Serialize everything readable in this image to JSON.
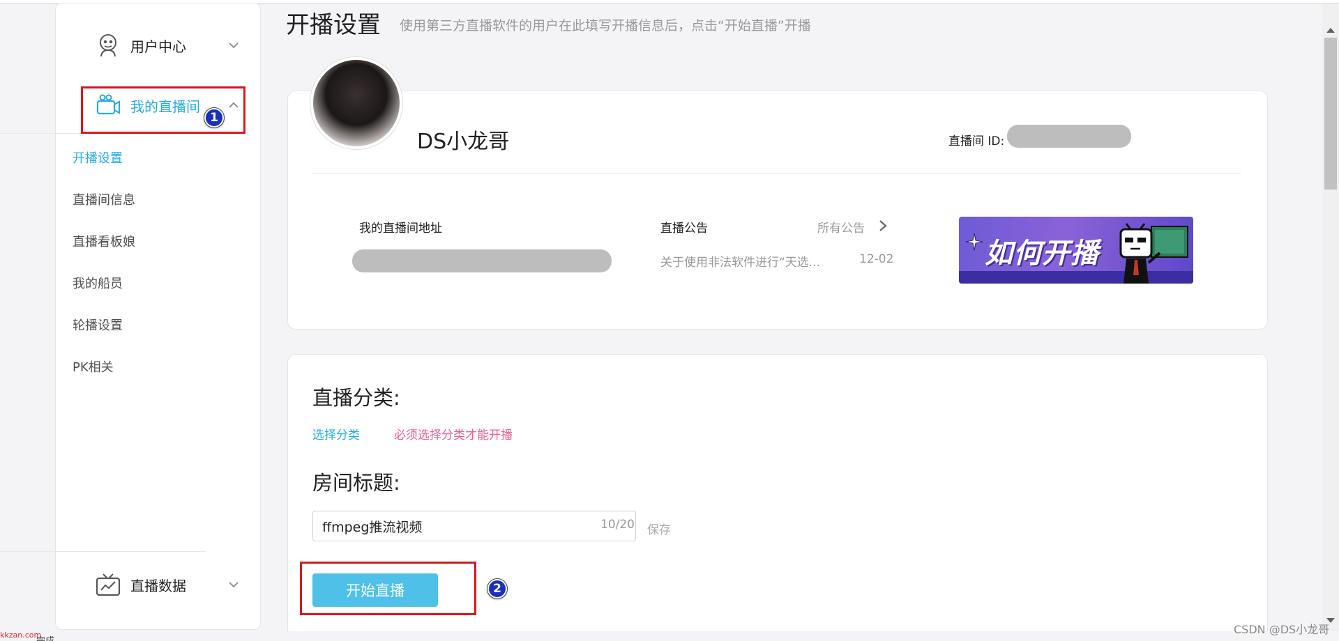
{
  "page": {
    "title": "开播设置",
    "description": "使用第三方直播软件的用户在此填写开播信息后，点击“开始直播”开播"
  },
  "sidebar": {
    "user_center": "用户中心",
    "my_live_room": "我的直播间",
    "sub_items": [
      {
        "label": "开播设置",
        "active": true
      },
      {
        "label": "直播间信息",
        "active": false
      },
      {
        "label": "直播看板娘",
        "active": false
      },
      {
        "label": "我的船员",
        "active": false
      },
      {
        "label": "轮播设置",
        "active": false
      },
      {
        "label": "PK相关",
        "active": false
      }
    ],
    "live_data": "直播数据"
  },
  "annotations": {
    "badge_1": "1",
    "badge_2": "2"
  },
  "profile": {
    "username": "DS小龙哥",
    "room_id_label": "直播间 ID:",
    "room_address_label": "我的直播间地址",
    "announcement_label": "直播公告",
    "all_announcements": "所有公告",
    "announcement_text": "关于使用非法软件进行“天选...",
    "announcement_date": "12-02",
    "banner_text": "如何开播"
  },
  "form": {
    "category_title": "直播分类:",
    "choose_category": "选择分类",
    "category_warning": "必须选择分类才能开播",
    "room_title_label": "房间标题:",
    "room_title_value": "ffmpeg推流视频",
    "char_count": "10/20",
    "save": "保存",
    "start_button": "开始直播"
  },
  "footer": {
    "watermark": "CSDN @DS小龙哥",
    "site_mark": "kkzan.com",
    "status_text": "完成"
  },
  "colors": {
    "accent": "#23ade5",
    "start_button": "#4fc1e9",
    "warning": "#f25d8e",
    "annotation_red": "#d9161c",
    "annotation_badge": "#1b2fbd"
  }
}
